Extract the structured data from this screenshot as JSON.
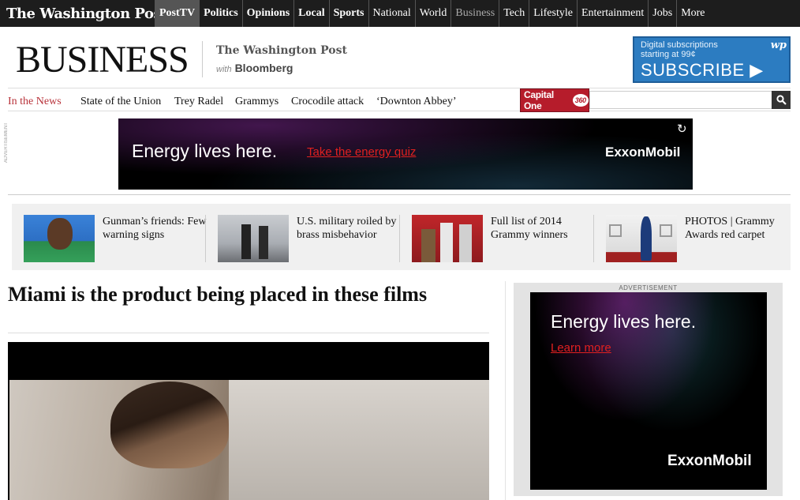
{
  "topnav": {
    "logo": "The Washington Post",
    "items": [
      {
        "label": "PostTV"
      },
      {
        "label": "Politics"
      },
      {
        "label": "Opinions"
      },
      {
        "label": "Local"
      },
      {
        "label": "Sports"
      },
      {
        "label": "National"
      },
      {
        "label": "World"
      },
      {
        "label": "Business"
      },
      {
        "label": "Tech"
      },
      {
        "label": "Lifestyle"
      },
      {
        "label": "Entertainment"
      },
      {
        "label": "Jobs"
      },
      {
        "label": "More"
      }
    ]
  },
  "header": {
    "section_title": "BUSINESS",
    "partner_logo": "The Washington Post",
    "with_label": "with",
    "partner": "Bloomberg"
  },
  "subscribe": {
    "line1": "Digital subscriptions",
    "line2": "starting at 99¢",
    "cta": "SUBSCRIBE ▶",
    "badge": "wp"
  },
  "trending": {
    "label": "In the News",
    "links": [
      "State of the Union",
      "Trey Radel",
      "Grammys",
      "Crocodile attack",
      "‘Downton Abbey’"
    ],
    "sponsor": "Capital One",
    "sponsor_badge": "360",
    "search_placeholder": ""
  },
  "ads": {
    "vertical_label": "ADVERTISEMENT",
    "banner": {
      "tagline": "Energy lives here.",
      "link": "Take the energy quiz",
      "brand": "ExxonMobil"
    },
    "side": {
      "label": "ADVERTISEMENT",
      "tagline": "Energy lives here.",
      "link": "Learn more",
      "brand": "ExxonMobil"
    }
  },
  "teasers": [
    {
      "title": "Gunman’s friends: Few warning signs"
    },
    {
      "title": "U.S. military roiled by brass misbehavior"
    },
    {
      "title": "Full list of 2014 Grammy winners"
    },
    {
      "title": "PHOTOS | Grammy Awards red carpet"
    }
  ],
  "article": {
    "headline": "Miami is the product being placed in these films"
  }
}
